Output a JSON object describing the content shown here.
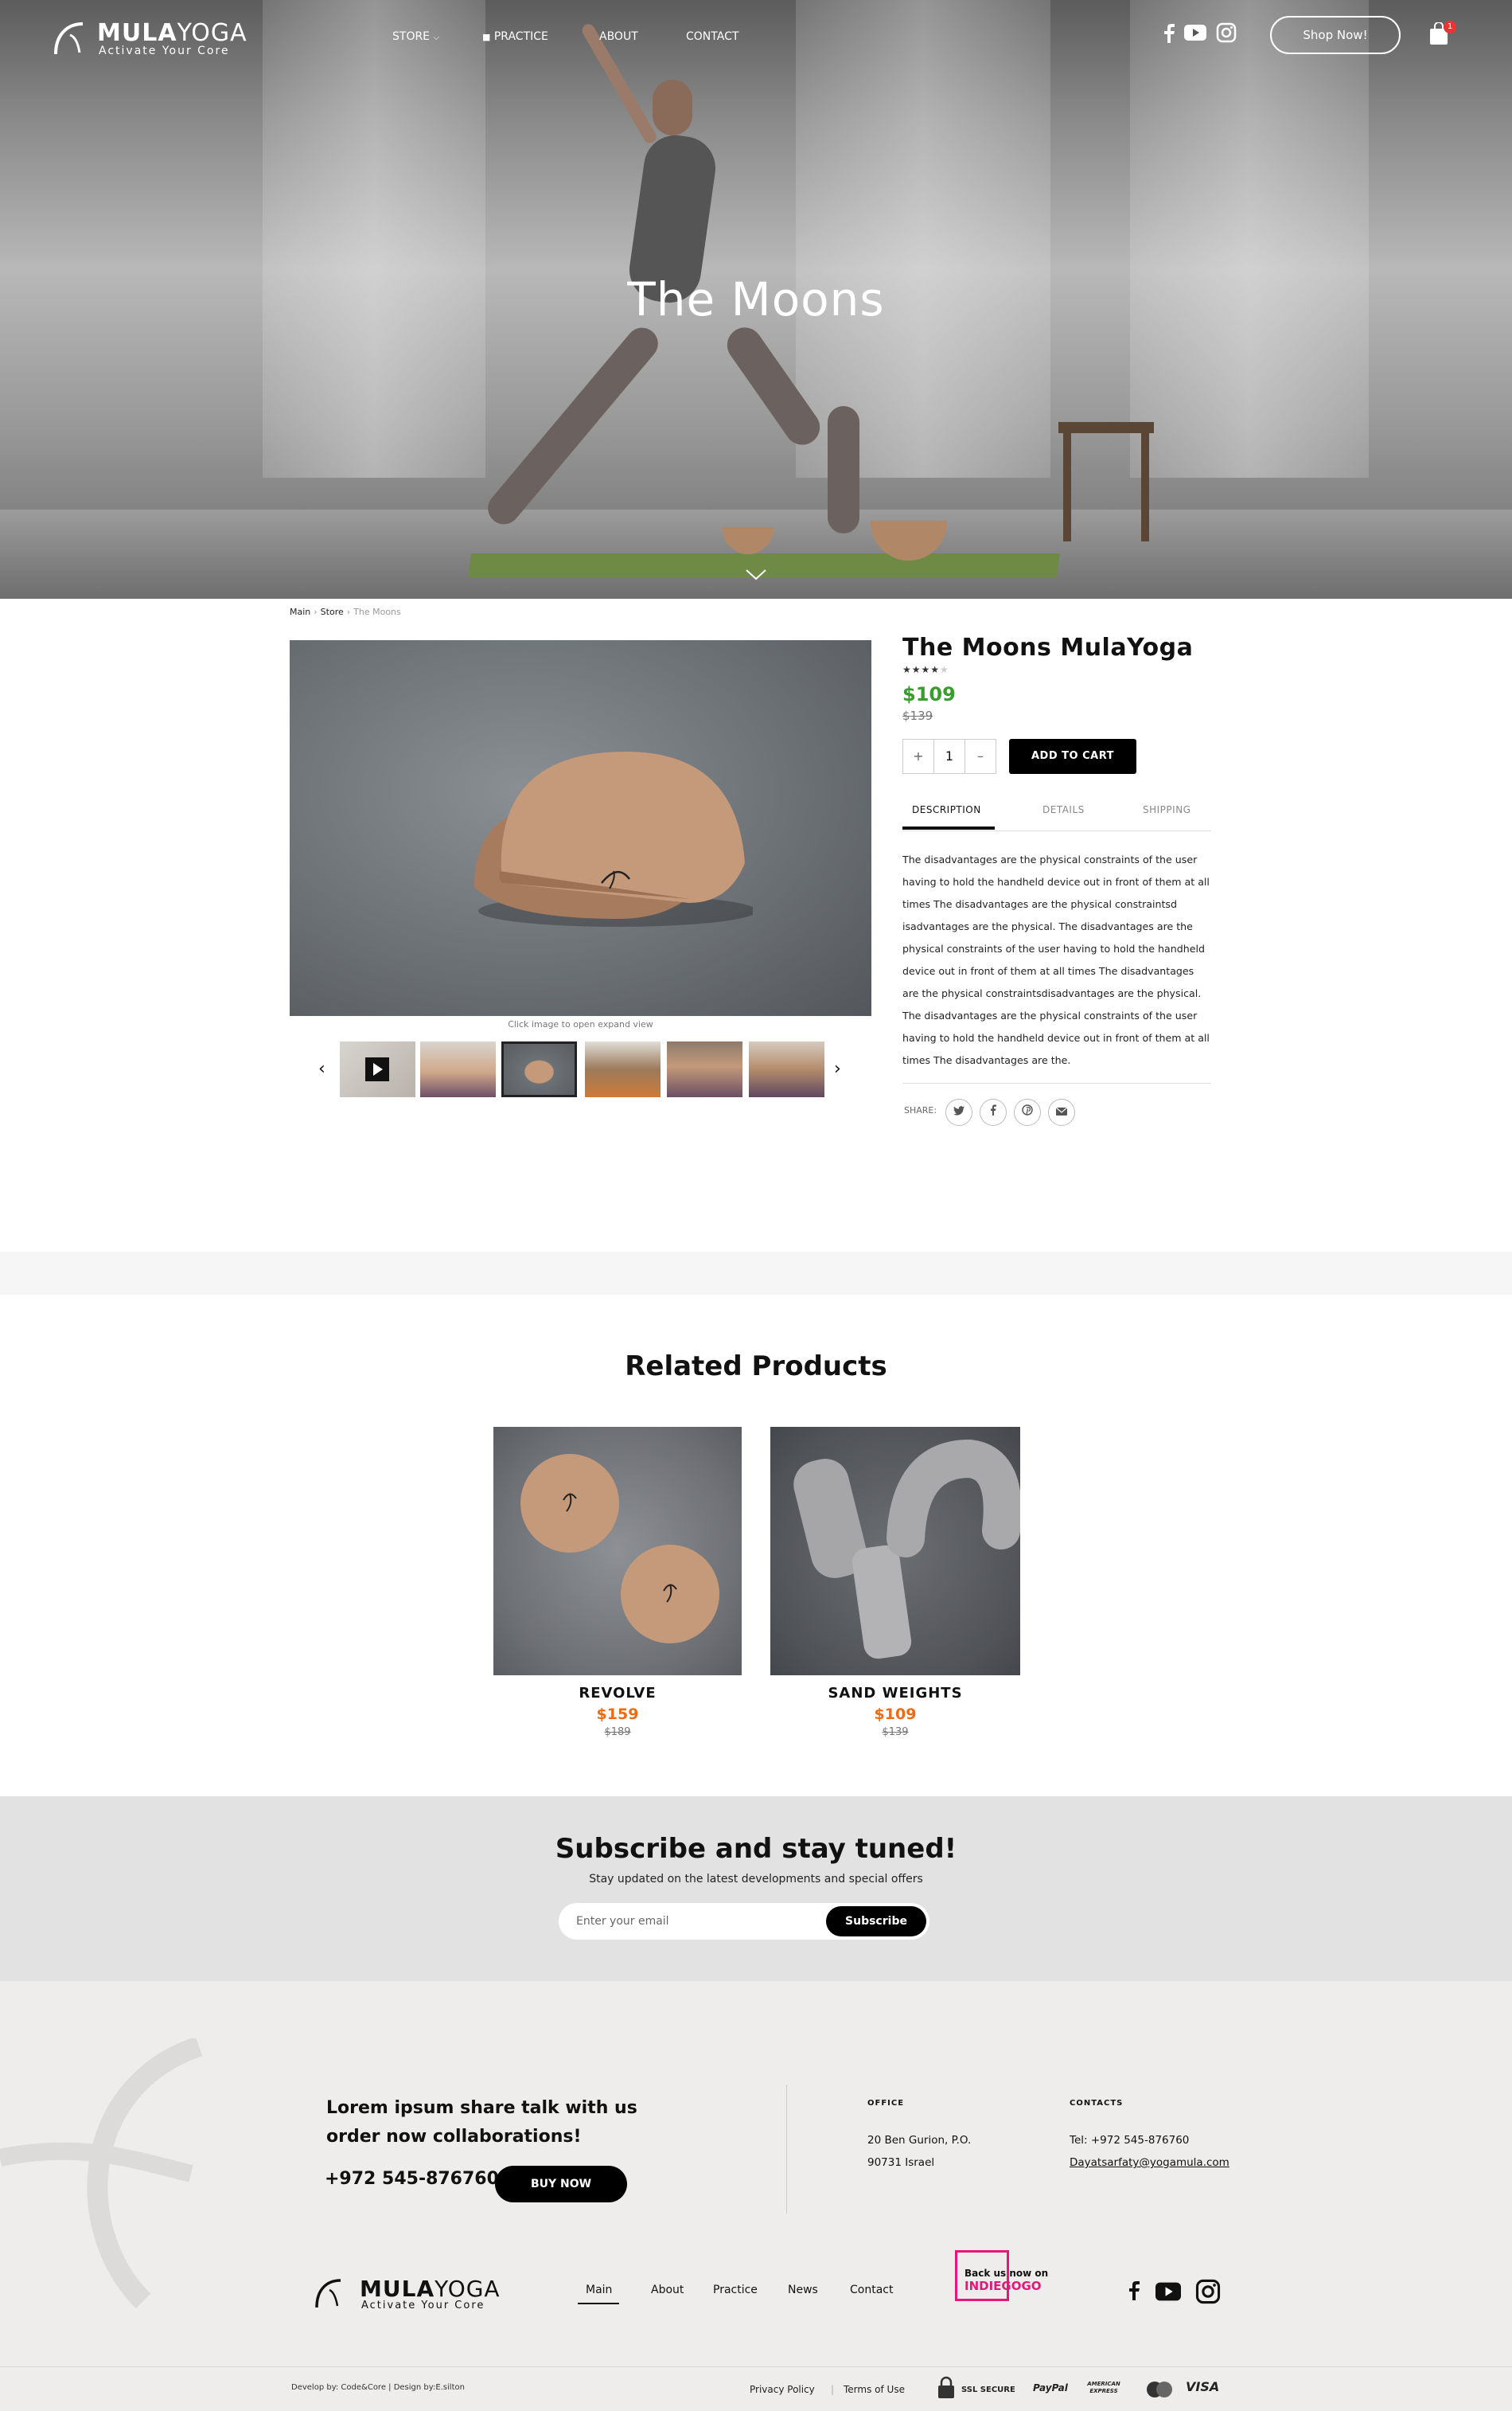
{
  "brand": {
    "name_bold": "MULA",
    "name_light": "YOGA",
    "tagline": "Activate Your Core"
  },
  "nav": {
    "links": [
      "STORE",
      "PRACTICE",
      "ABOUT",
      "CONTACT"
    ],
    "shop_now": "Shop Now!",
    "cart_count": "1",
    "social_icons": [
      "facebook-icon",
      "youtube-icon",
      "instagram-icon"
    ]
  },
  "hero": {
    "title": "The Moons"
  },
  "breadcrumb": {
    "items": [
      "Main",
      "Store",
      "The Moons"
    ]
  },
  "gallery": {
    "caption": "Click image to open expand view",
    "thumbnail_count": 6,
    "active_thumbnail": 3
  },
  "product": {
    "title": "The Moons MulaYoga",
    "rating": 4,
    "rating_max": 5,
    "price": "$109",
    "old_price": "$139",
    "quantity": "1",
    "qty_plus": "+",
    "qty_minus": "–",
    "add_to_cart": "ADD TO CART",
    "tabs": [
      "DESCRIPTION",
      "DETAILS",
      "SHIPPING"
    ],
    "active_tab": "DESCRIPTION",
    "description": "The disadvantages are the physical constraints of the user having to hold the handheld device out in front of them at all times The disadvantages are the physical constraintsd isadvantages are the physical. The disadvantages are the physical constraints of the user having to hold the handheld device out in front of them at all times The disadvantages are the physical constraintsdisadvantages are the physical. The disadvantages are the physical constraints of the user having to hold the handheld device out in front of them at all times The disadvantages are the.",
    "share_label": "SHARE:"
  },
  "related": {
    "title": "Related Products",
    "items": [
      {
        "name": "REVOLVE",
        "price": "$159",
        "old_price": "$189"
      },
      {
        "name": "SAND WEIGHTS",
        "price": "$109",
        "old_price": "$139"
      }
    ]
  },
  "subscribe": {
    "title": "Subscribe and stay tuned!",
    "subtitle": "Stay updated on the latest developments and special offers",
    "placeholder": "Enter your email",
    "button": "Subscribe"
  },
  "footer": {
    "lead": "Lorem ipsum share talk with us order now collaborations!",
    "phone": "+972 545-876760",
    "buy_now": "BUY NOW",
    "office_head": "OFFICE",
    "office_line1": "20 Ben Gurion, P.O.",
    "office_line2": "90731 Israel",
    "contacts_head": "CONTACTS",
    "contacts_tel": "Tel: +972 545-876760",
    "contacts_email": "Dayatsarfaty@yogamula.com",
    "nav": [
      "Main",
      "About",
      "Practice",
      "News",
      "Contact"
    ],
    "indiegogo_line1": "Back us now on",
    "indiegogo_line2": "INDIEGOGO",
    "credit": "Develop by: Code&Core | Design by:E.silton",
    "privacy": "Privacy Policy",
    "terms": "Terms of Use",
    "ssl": "SSL SECURE",
    "payments": [
      "PayPal",
      "AMERICAN EXPRESS",
      "VISA"
    ]
  },
  "colors": {
    "price_green": "#3a9b2e",
    "price_orange": "#ef6a12",
    "indiegogo_pink": "#e5187a"
  }
}
